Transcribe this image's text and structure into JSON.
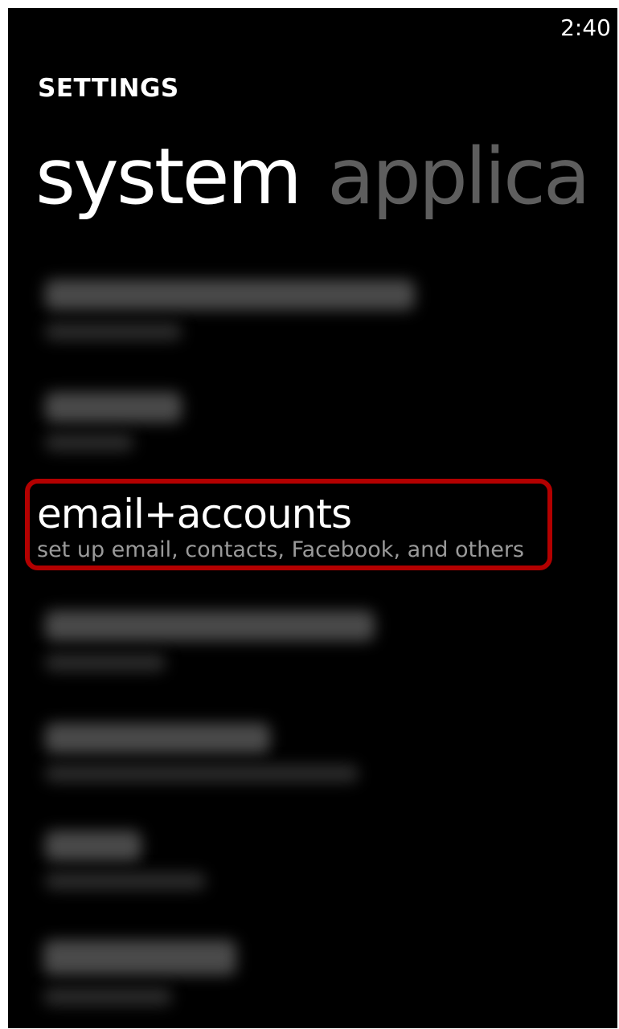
{
  "status_bar": {
    "time": "2:40"
  },
  "app": {
    "title": "SETTINGS"
  },
  "pivot": {
    "active_label": "system",
    "next_label_visible": "applica"
  },
  "settings_list": {
    "email_accounts": {
      "title": "email+accounts",
      "subtitle": "set up email, contacts, Facebook, and others",
      "highlighted": true
    }
  },
  "colors": {
    "background": "#000000",
    "text_primary": "#ffffff",
    "text_secondary": "#9a9a9a",
    "pivot_inactive": "#5e5e5e",
    "highlight_border": "#b30000"
  }
}
